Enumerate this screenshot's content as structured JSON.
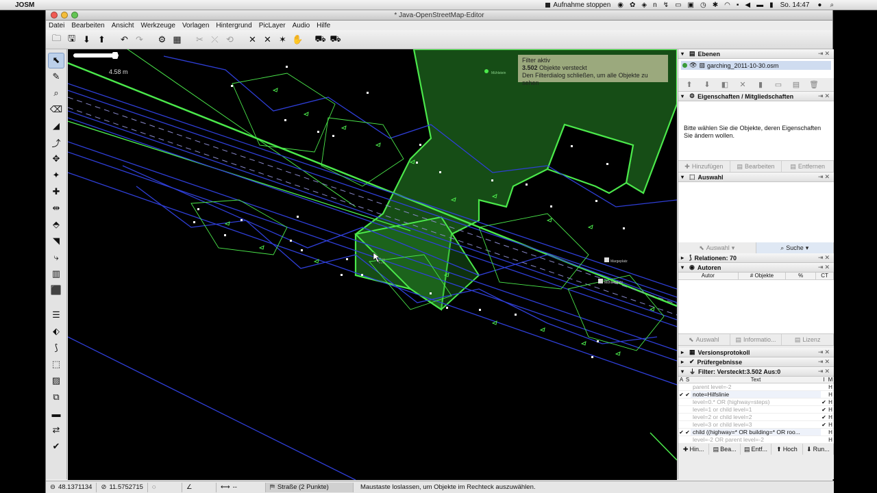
{
  "menubar": {
    "app_name": "JOSM",
    "recording": "Aufnahme stoppen",
    "clock": "So. 14:47"
  },
  "window": {
    "title": "* Java-OpenStreetMap-Editor"
  },
  "menu": [
    "Datei",
    "Bearbeiten",
    "Ansicht",
    "Werkzeuge",
    "Vorlagen",
    "Hintergrund",
    "PicLayer",
    "Audio",
    "Hilfe"
  ],
  "map": {
    "scale": "4.58 m",
    "filter_title": "Filter aktiv",
    "filter_count": "3.502",
    "filter_hidden": "Objekte versteckt",
    "filter_hint": "Den Filterdialog schließen, um alle Objekte zu sehen",
    "poi_labels": [
      "Mühlstein",
      "Margeplatz",
      "Mühlenplatz"
    ]
  },
  "panels": {
    "layers": {
      "title": "Ebenen",
      "item": "garching_2011-10-30.osm"
    },
    "properties": {
      "title": "Eigenschaften / Mitgliedschaften",
      "message": "Bitte wählen Sie die Objekte, deren Eigenschaften Sie ändern wollen.",
      "buttons": [
        "Hinzufügen",
        "Bearbeiten",
        "Entfernen"
      ]
    },
    "selection": {
      "title": "Auswahl",
      "buttons": [
        "Auswahl",
        "Suche"
      ]
    },
    "relations": {
      "title": "Relationen: 70"
    },
    "authors": {
      "title": "Autoren",
      "columns": [
        "Autor",
        "# Objekte",
        "%",
        "CT"
      ],
      "buttons": [
        "Auswahl",
        "Informatio...",
        "Lizenz"
      ]
    },
    "history": {
      "title": "Versionsprotokoll"
    },
    "validator": {
      "title": "Prüfergebnisse"
    },
    "filter": {
      "title": "Filter: Versteckt:3.502 Aus:0",
      "columns": [
        "A",
        "S",
        "Text",
        "I",
        "M"
      ],
      "rows": [
        {
          "a": "",
          "s": "",
          "text": "parent level=-2",
          "i": "",
          "m": "H"
        },
        {
          "a": "✔",
          "s": "✔",
          "text": "note=Hilfslinie",
          "i": "",
          "m": "H"
        },
        {
          "a": "",
          "s": "",
          "text": "level=0.* OR (highway=steps)",
          "i": "✔",
          "m": "H"
        },
        {
          "a": "",
          "s": "",
          "text": "level=1 or child level=1",
          "i": "✔",
          "m": "H"
        },
        {
          "a": "",
          "s": "",
          "text": "level=2 or child level=2",
          "i": "✔",
          "m": "H"
        },
        {
          "a": "",
          "s": "",
          "text": "level=3 or child level=3",
          "i": "✔",
          "m": "H"
        },
        {
          "a": "✔",
          "s": "✔",
          "text": "child ((highway=* OR building=* OR roo...",
          "i": "",
          "m": "H"
        },
        {
          "a": "",
          "s": "",
          "text": "level=-2 OR parent level=-2",
          "i": "",
          "m": "H"
        }
      ],
      "buttons": [
        "Hin...",
        "Bea...",
        "Entf...",
        "Hoch",
        "Run..."
      ]
    }
  },
  "status": {
    "lat": "48.1371134",
    "lon": "11.5752715",
    "heading": "",
    "angle": "",
    "length": "--",
    "way": "Straße (2 Punkte)",
    "message": "Maustaste loslassen, um Objekte im Rechteck auszuwählen."
  },
  "colors": {
    "area_green": "#4be84b",
    "way_blue": "#2f3fd8",
    "map_bg": "#000000"
  }
}
